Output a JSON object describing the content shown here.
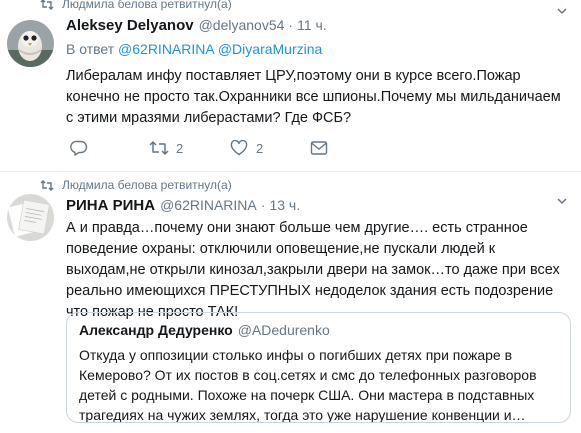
{
  "tweets": [
    {
      "retweeted_by": "Людмила белова ретвитнул(а)",
      "author_name": "Aleksey Delyanov",
      "author_handle": "@delyanov54",
      "separator": "·",
      "time": "11 ч.",
      "reply_prefix": "В ответ",
      "reply_to_1": "@62RINARINA",
      "reply_to_2": "@DiyaraMurzina",
      "text": "Либералам инфу поставляет ЦРУ,поэтому они в курсе всего.Пожар конечно не просто так.Охранники все шпионы.Почему мы мильданичаем с этими мразями либерастами? Где ФСБ?",
      "retweet_count": "2",
      "like_count": "2",
      "icons": [
        "reply-icon",
        "retweet-icon",
        "like-icon",
        "dm-icon",
        "chevron-down-icon",
        "avatar-image"
      ]
    },
    {
      "retweeted_by": "Людмила белова ретвитнул(а)",
      "author_name": "РИНА РИНА",
      "author_handle": "@62RINARINA",
      "separator": "·",
      "time": "13 ч.",
      "text": "А и правда…почему они знают больше чем другие…. есть странное поведение охраны: отключили оповещение,не пускали людей к выходам,не открыли кинозал,закрыли двери на замок…то даже при всех реально имеющихся ПРЕСТУПНЫХ недоделок здания есть подозрение что пожар не просто ТАК!",
      "quote": {
        "author_name": "Александр Дедуренко",
        "author_handle": "@ADedurenko",
        "text": "Откуда у оппозиции столько инфы о погибших детях при пожаре в Кемерово? От их постов в соц.сетях и смс до телефонных разговоров детей с родными. Похоже на почерк США. Они мастера в подставных трагедиях на чужих землях, тогда это уже нарушение конвенции и…"
      }
    }
  ]
}
